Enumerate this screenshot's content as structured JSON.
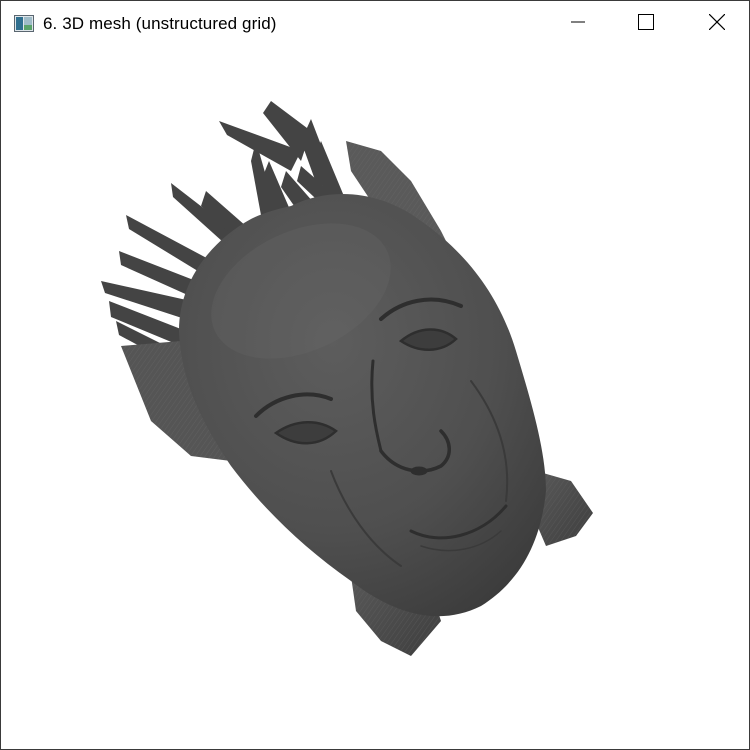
{
  "window": {
    "title": "6. 3D mesh (unstructured grid)",
    "controls": {
      "minimize": "minimize-icon",
      "maximize": "maximize-icon",
      "close": "close-icon"
    }
  },
  "viewport": {
    "object": "head-mesh",
    "mesh_color": "#4f4f4f",
    "background": "#ffffff"
  }
}
